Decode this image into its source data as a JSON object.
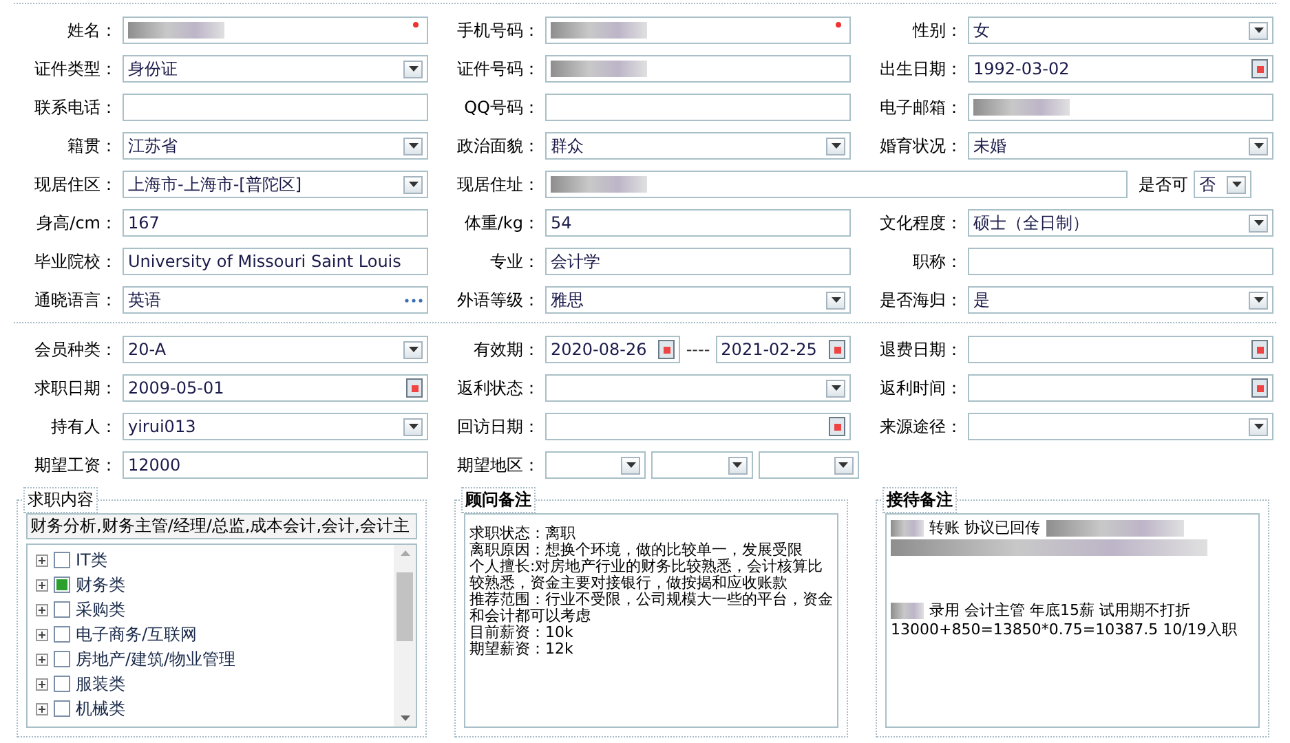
{
  "personal": {
    "rows": [
      [
        {
          "label": "姓名：",
          "kind": "text",
          "redacted": true,
          "required": true
        },
        {
          "label": "手机号码：",
          "kind": "text",
          "redacted": true,
          "required": true
        },
        {
          "label": "性别：",
          "kind": "select",
          "value": "女"
        }
      ],
      [
        {
          "label": "证件类型：",
          "kind": "select",
          "value": "身份证"
        },
        {
          "label": "证件号码：",
          "kind": "text",
          "redacted": true
        },
        {
          "label": "出生日期：",
          "kind": "date",
          "value": "1992-03-02"
        }
      ],
      [
        {
          "label": "联系电话：",
          "kind": "text"
        },
        {
          "label": "QQ号码：",
          "kind": "text"
        },
        {
          "label": "电子邮箱：",
          "kind": "text",
          "redacted": true
        }
      ],
      [
        {
          "label": "籍贯：",
          "kind": "select",
          "value": "江苏省"
        },
        {
          "label": "政治面貌：",
          "kind": "select",
          "value": "群众"
        },
        {
          "label": "婚育状况：",
          "kind": "select",
          "value": "未婚"
        }
      ],
      [
        {
          "label": "现居住区：",
          "kind": "select",
          "value": "上海市-上海市-[普陀区]"
        },
        {
          "label": "现居住址：",
          "kind": "text",
          "redacted": true,
          "wide": true
        },
        {
          "label": "是否可",
          "kind": "select",
          "value": "否",
          "compact": true
        }
      ],
      [
        {
          "label": "身高/cm：",
          "kind": "text",
          "value": "167"
        },
        {
          "label": "体重/kg：",
          "kind": "text",
          "value": "54"
        },
        {
          "label": "文化程度：",
          "kind": "select",
          "value": "硕士（全日制）"
        }
      ],
      [
        {
          "label": "毕业院校：",
          "kind": "text",
          "value": "University of Missouri Saint Louis"
        },
        {
          "label": "专业：",
          "kind": "text",
          "value": "会计学"
        },
        {
          "label": "职称：",
          "kind": "text"
        }
      ],
      [
        {
          "label": "通晓语言：",
          "kind": "lookup",
          "value": "英语"
        },
        {
          "label": "外语等级：",
          "kind": "select",
          "value": "雅思"
        },
        {
          "label": "是否海归：",
          "kind": "select",
          "value": "是"
        }
      ]
    ]
  },
  "membership": {
    "rows": [
      [
        {
          "label": "会员种类：",
          "kind": "select",
          "value": "20-A"
        },
        {
          "label": "有效期：",
          "kind": "date_range",
          "values": [
            "2020-08-26",
            "2021-02-25"
          ],
          "separator": "----"
        },
        {
          "label": "退费日期：",
          "kind": "date"
        }
      ],
      [
        {
          "label": "求职日期：",
          "kind": "date",
          "value": "2009-05-01"
        },
        {
          "label": "返利状态：",
          "kind": "select"
        },
        {
          "label": "返利时间：",
          "kind": "date"
        }
      ],
      [
        {
          "label": "持有人：",
          "kind": "select",
          "value": "yirui013"
        },
        {
          "label": "回访日期：",
          "kind": "date"
        },
        {
          "label": "来源途径：",
          "kind": "select"
        }
      ],
      [
        {
          "label": "期望工资：",
          "kind": "text",
          "value": "12000"
        },
        {
          "label": "期望地区：",
          "kind": "multi_select"
        }
      ]
    ]
  },
  "job_content": {
    "title": "求职内容",
    "summary": "财务分析,财务主管/经理/总监,成本会计,会计,会计主",
    "tree": [
      {
        "label": "IT类",
        "checked": false
      },
      {
        "label": "财务类",
        "checked": true
      },
      {
        "label": "采购类",
        "checked": false
      },
      {
        "label": "电子商务/互联网",
        "checked": false
      },
      {
        "label": "房地产/建筑/物业管理",
        "checked": false
      },
      {
        "label": "服装类",
        "checked": false
      },
      {
        "label": "机械类",
        "checked": false
      }
    ]
  },
  "consultant_notes": {
    "title": "顾问备注",
    "lines": [
      "求职状态：离职",
      "离职原因：想换个环境，做的比较单一，发展受限",
      "个人擅长:对房地产行业的财务比较熟悉，会计核算比较熟悉，资金主要对接银行，做按揭和应收账款",
      "推荐范围：行业不受限，公司规模大一些的平台，资金和会计都可以考虑",
      "目前薪资：10k",
      "期望薪资：12k"
    ]
  },
  "reception_notes": {
    "title": "接待备注",
    "lines": [
      {
        "segments": [
          {
            "kind": "redacted"
          },
          {
            "kind": "text",
            "text": "转账  协议已回传"
          },
          {
            "kind": "redacted_long"
          }
        ]
      },
      {
        "segments": [
          {
            "kind": "redacted_line"
          }
        ]
      },
      {
        "gap_before": true,
        "segments": [
          {
            "kind": "redacted"
          },
          {
            "kind": "text",
            "text": "录用  会计主管   年底15薪   试用期不打折"
          }
        ]
      },
      {
        "segments": [
          {
            "kind": "text",
            "text": "13000+850=13850*0.75=10387.5  10/19入职"
          }
        ]
      }
    ]
  }
}
